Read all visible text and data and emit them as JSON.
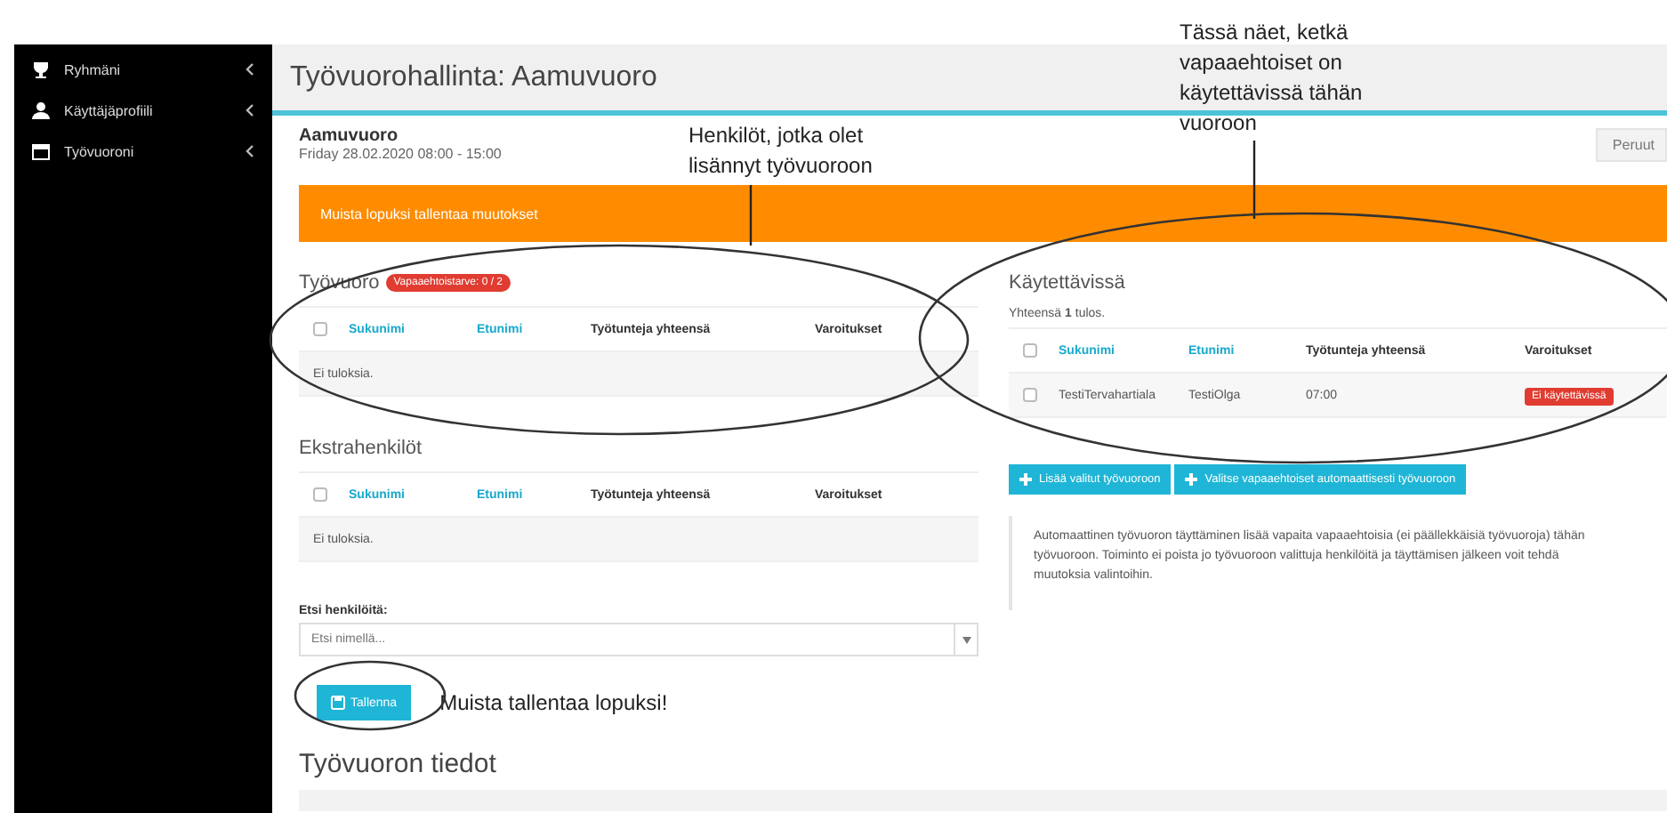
{
  "sidebar": {
    "items": [
      {
        "label": "Ryhmäni"
      },
      {
        "label": "Käyttäjäprofiili"
      },
      {
        "label": "Työvuoroni"
      }
    ]
  },
  "page_title": "Työvuorohallinta: Aamuvuoro",
  "shift": {
    "name": "Aamuvuoro",
    "datetime": "Friday 28.02.2020 08:00 - 15:00"
  },
  "cancel_button": "Peruut",
  "alert": "Muista lopuksi tallentaa muutokset",
  "shift_table": {
    "title": "Työvuoro",
    "badge": "Vapaaehtoistarve: 0 / 2",
    "select_all_checked": false,
    "columns": [
      "Sukunimi",
      "Etunimi",
      "Työtunteja yhteensä",
      "Varoitukset"
    ],
    "empty": "Ei tuloksia."
  },
  "extra_table": {
    "title": "Ekstrahenkilöt",
    "select_all_checked": false,
    "columns": [
      "Sukunimi",
      "Etunimi",
      "Työtunteja yhteensä",
      "Varoitukset"
    ],
    "empty": "Ei tuloksia."
  },
  "search": {
    "label": "Etsi henkilöitä:",
    "placeholder": "Etsi nimellä..."
  },
  "save_button": "Tallenna",
  "available": {
    "title": "Käytettävissä",
    "summary": "Yhteensä **1** tulos.",
    "select_all_checked": false,
    "columns": [
      "Sukunimi",
      "Etunimi",
      "Työtunteja yhteensä",
      "Varoitukset"
    ],
    "rows": [
      {
        "checked": false,
        "cells": [
          "TestiTervahartiala",
          "TestiOlga",
          "07:00"
        ],
        "warning": "Ei käytettävissä"
      }
    ]
  },
  "actions": [
    "Lisää valitut työvuoroon",
    "Valitse vapaaehtoiset automaattisesti työvuoroon"
  ],
  "note": "Automaattinen työvuoron täyttäminen lisää vapaita vapaaehtoisia (ei päällekkäisiä työvuoroja) tähän työvuoroon. Toiminto ei poista jo työvuoroon valittuja henkilöitä ja täyttämisen jälkeen voit tehdä muutoksia valintoihin.",
  "details_title": "Työvuoron tiedot",
  "annotations": [
    {
      "kind": "callout",
      "text": "Henkilöt, jotka olet lisännyt työvuoroon"
    },
    {
      "kind": "callout",
      "text": "Tässä näet, ketkä vapaaehtoiset on käytettävissä tähän vuoroon"
    },
    {
      "kind": "inline",
      "text": "Muista tallentaa lopuksi!"
    }
  ]
}
